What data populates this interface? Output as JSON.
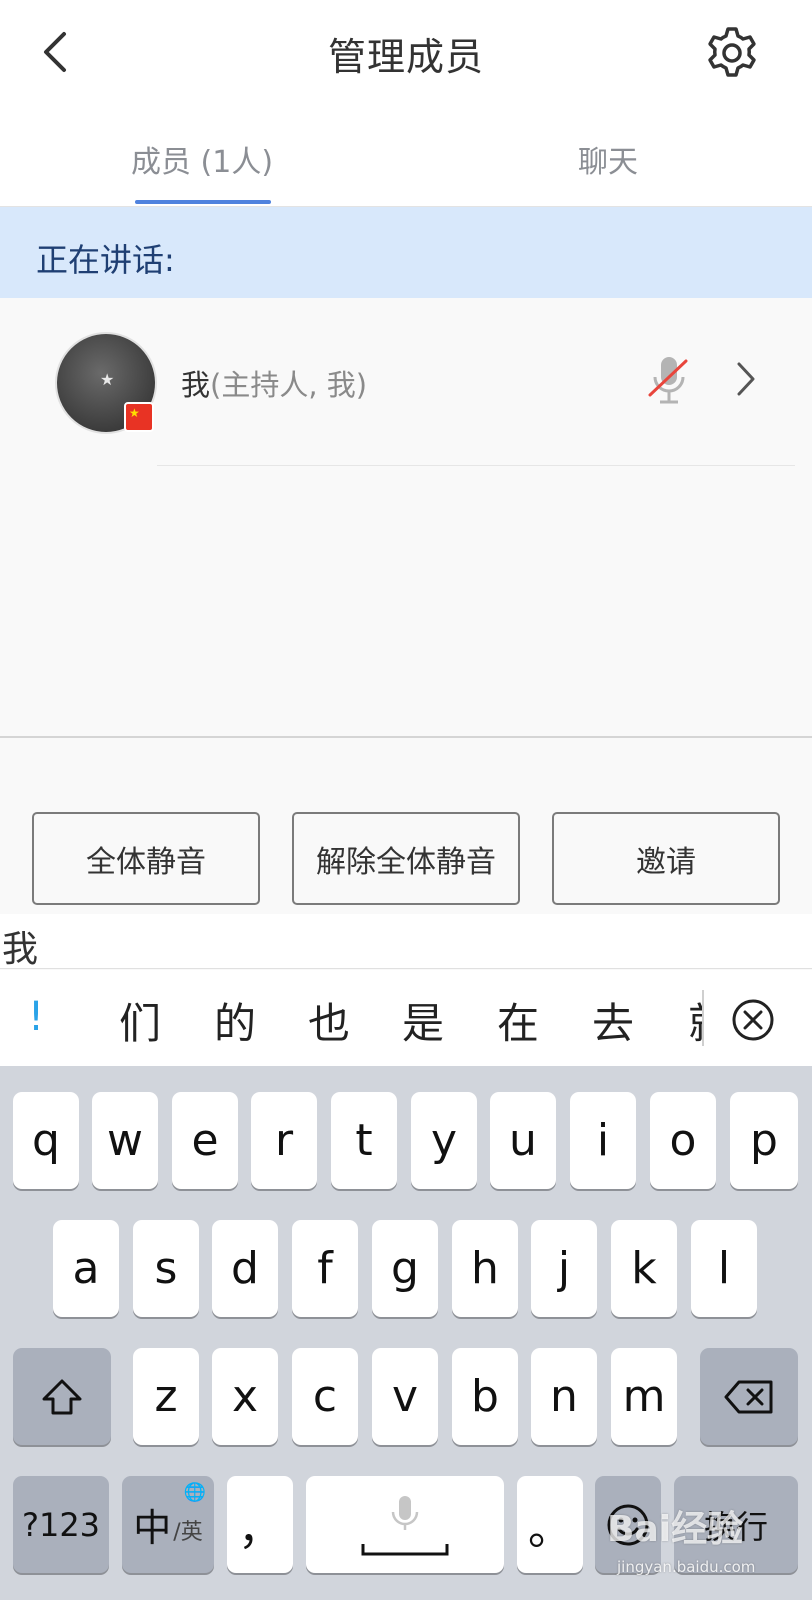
{
  "header": {
    "title": "管理成员"
  },
  "tabs": [
    {
      "label": "成员 (1人)",
      "active": true
    },
    {
      "label": "聊天",
      "active": false
    }
  ],
  "speaking": {
    "label": "正在讲话:"
  },
  "members": [
    {
      "name": "我",
      "role": "(主持人, 我)",
      "mic": "muted"
    }
  ],
  "actions": {
    "mute_all": "全体静音",
    "unmute_all": "解除全体静音",
    "invite": "邀请"
  },
  "ime": {
    "composition": "我",
    "candidates": [
      "!",
      "们",
      "的",
      "也",
      "是",
      "在",
      "去",
      "就"
    ]
  },
  "keyboard": {
    "row1": [
      "q",
      "w",
      "e",
      "r",
      "t",
      "y",
      "u",
      "i",
      "o",
      "p"
    ],
    "row2": [
      "a",
      "s",
      "d",
      "f",
      "g",
      "h",
      "j",
      "k",
      "l"
    ],
    "row3": [
      "z",
      "x",
      "c",
      "v",
      "b",
      "n",
      "m"
    ],
    "numbers_key": "?123",
    "lang_key_main": "中",
    "lang_key_sub": "/英",
    "comma_key": "，",
    "period_key": "。",
    "return_key": "换行"
  },
  "watermark": {
    "logo": "Bai经验",
    "url": "jingyan.baidu.com"
  },
  "colors": {
    "accent": "#4f82de",
    "banner": "#d8e8fb",
    "muted_mic": "#e8453c"
  }
}
